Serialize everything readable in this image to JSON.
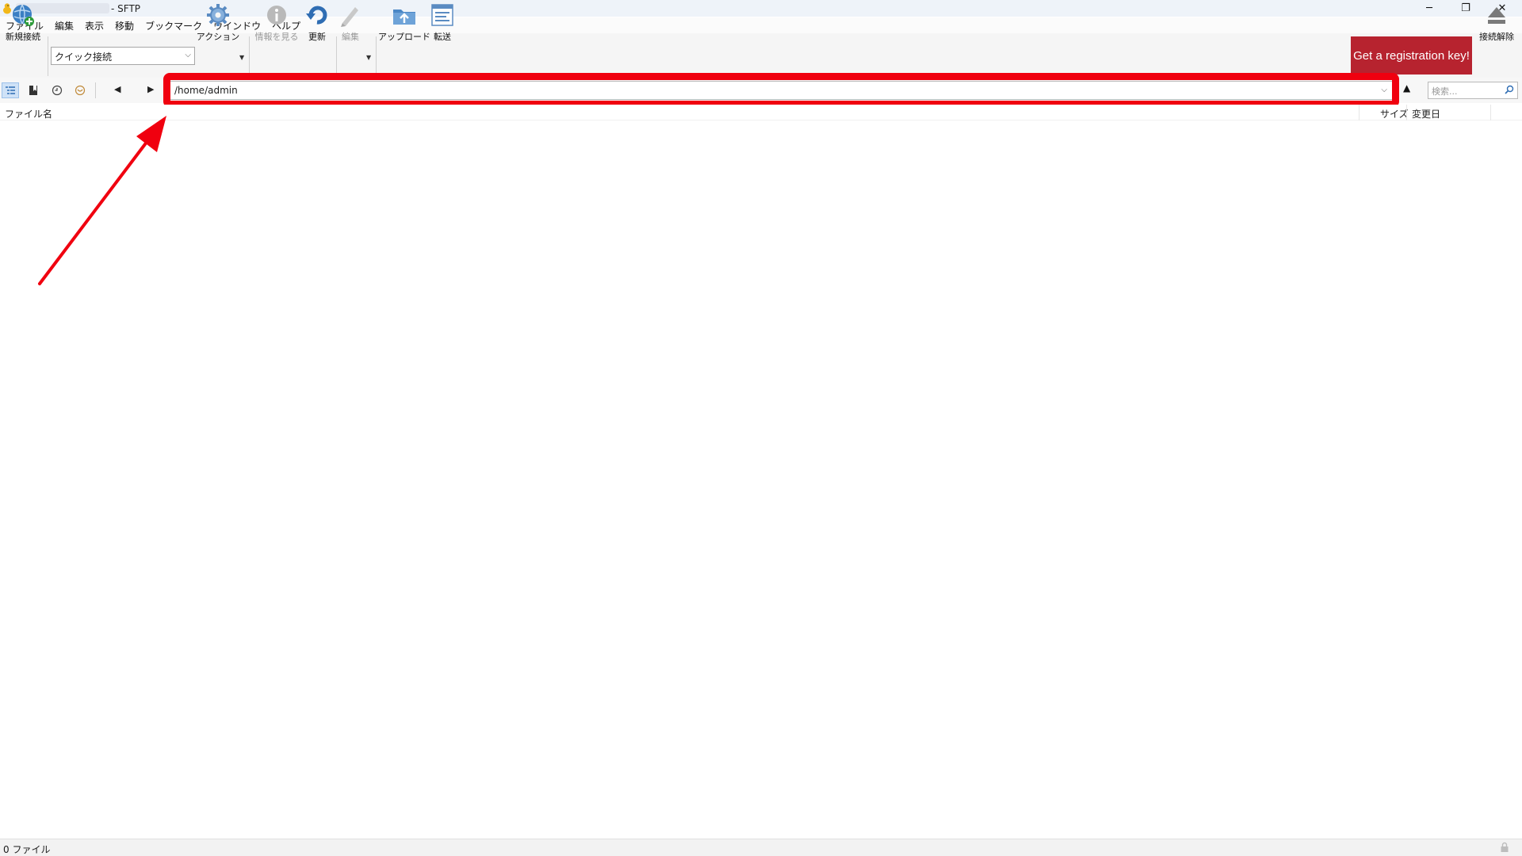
{
  "window": {
    "title": "- SFTP",
    "min_label": "─",
    "max_label": "❐",
    "close_label": "✕"
  },
  "menu": [
    "ファイル",
    "編集",
    "表示",
    "移動",
    "ブックマーク",
    "ウインドウ",
    "ヘルプ"
  ],
  "toolbar": {
    "new_connection": "新規接続",
    "quick_connect": "クイック接続",
    "action": "アクション",
    "info": "情報を見る",
    "refresh": "更新",
    "edit": "編集",
    "upload": "アップロード",
    "transfer": "転送",
    "registration": "Get a registration key!",
    "disconnect": "接続解除"
  },
  "pathbar": {
    "path": "/home/admin",
    "search_placeholder": "検索..."
  },
  "columns": {
    "name": "ファイル名",
    "size": "サイズ",
    "modified": "変更日"
  },
  "status": {
    "count": "0 ファイル"
  },
  "colors": {
    "accent_red": "#f0000f",
    "registration_bg": "#b7232f"
  }
}
